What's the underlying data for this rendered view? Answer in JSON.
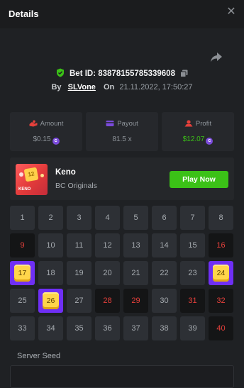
{
  "header": {
    "title": "Details",
    "close_icon": "close-icon"
  },
  "bet": {
    "id_text": "Bet ID: 83878155785339608",
    "by_label": "By",
    "username": "SLVone",
    "on_label": "On",
    "datetime": "21.11.2022, 17:50:27",
    "verified_icon": "shield-check-icon",
    "copy_icon": "copy-icon",
    "share_icon": "share-icon"
  },
  "stats": {
    "amount": {
      "label": "Amount",
      "value": "$0.15",
      "icon": "hand-coin-icon"
    },
    "payout": {
      "label": "Payout",
      "value": "81.5 x",
      "icon": "wallet-icon"
    },
    "profit": {
      "label": "Profit",
      "value": "$12.07",
      "icon": "profit-icon"
    }
  },
  "colors": {
    "accent_green": "#3bc117",
    "miss_red": "#e5403b",
    "hit_purple": "#6f2ff5",
    "gem_yellow": "#ffd54a",
    "coin_purple": "#7b4bdb"
  },
  "game": {
    "name": "Keno",
    "provider": "BC Originals",
    "play_label": "Play Now",
    "thumbnail_text": "KENO"
  },
  "keno": {
    "hits": [
      17,
      24,
      26
    ],
    "misses": [
      9,
      16,
      28,
      29,
      31,
      32,
      40
    ],
    "cells": [
      "1",
      "2",
      "3",
      "4",
      "5",
      "6",
      "7",
      "8",
      "9",
      "10",
      "11",
      "12",
      "13",
      "14",
      "15",
      "16",
      "17",
      "18",
      "19",
      "20",
      "21",
      "22",
      "23",
      "24",
      "25",
      "26",
      "27",
      "28",
      "29",
      "30",
      "31",
      "32",
      "33",
      "34",
      "35",
      "36",
      "37",
      "38",
      "39",
      "40"
    ]
  },
  "seed": {
    "label": "Server Seed"
  }
}
